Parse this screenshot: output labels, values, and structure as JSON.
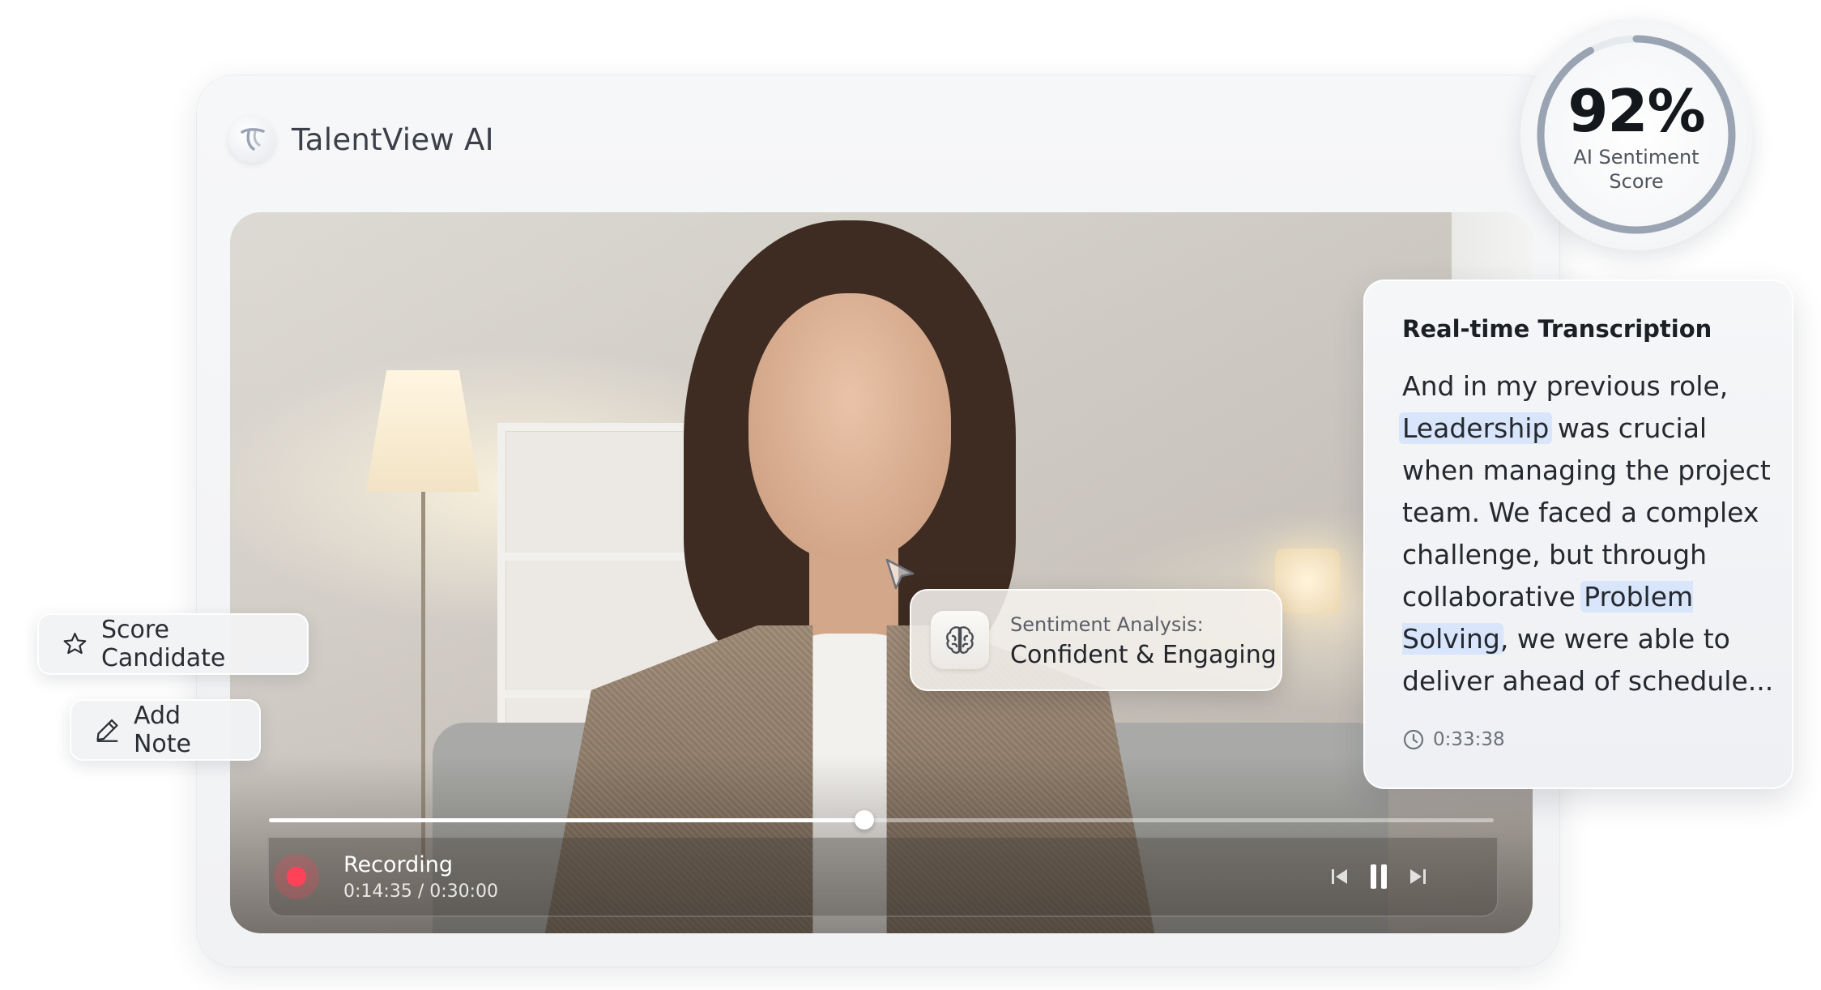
{
  "app": {
    "name": "TalentView AI"
  },
  "score": {
    "value": "92%",
    "label": "AI Sentiment Score",
    "fraction": 0.92
  },
  "player": {
    "status": "Recording",
    "current_time": "0:14:35",
    "separator": "/",
    "total_time": "0:30:00",
    "progress": 0.486
  },
  "sentiment": {
    "label": "Sentiment Analysis:",
    "value": "Confident & Engaging"
  },
  "transcript": {
    "title": "Real-time Transcription",
    "segments": [
      {
        "text": "And in my previous role, ",
        "highlight": false
      },
      {
        "text": "Leadership",
        "highlight": true
      },
      {
        "text": " was crucial when managing the project team. We faced a complex challenge, but through collaborative ",
        "highlight": false
      },
      {
        "text": "Problem Solving",
        "highlight": true
      },
      {
        "text": ", we were able to deliver ahead of schedule...",
        "highlight": false
      }
    ],
    "timestamp": "0:33:38"
  },
  "actions": {
    "score_label": "Score Candidate",
    "note_label": "Add Note"
  },
  "colors": {
    "accent": "#d8e5fa",
    "record": "#ff4257",
    "ring": "#9aa3b2"
  },
  "icons": [
    "brand-logo-icon",
    "star-icon",
    "pencil-icon",
    "brain-icon",
    "clock-icon",
    "skip-back-icon",
    "pause-icon",
    "skip-forward-icon",
    "cursor-icon"
  ]
}
